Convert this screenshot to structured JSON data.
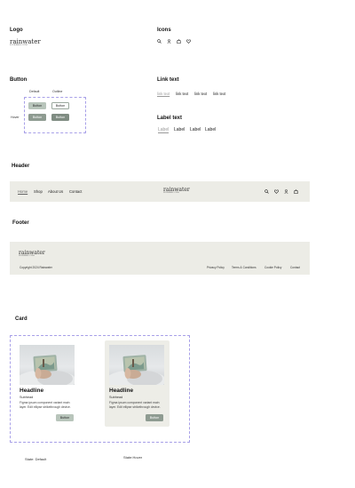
{
  "sections": {
    "logo": "Logo",
    "icons": "Icons",
    "button": "Button",
    "link_text": "Link text",
    "label_text": "Label text",
    "header": "Header",
    "footer": "Footer",
    "card": "Card"
  },
  "brand": {
    "name": "rainwater",
    "tagline": "SUSTAINABLE LIVING"
  },
  "icons": [
    "search-icon",
    "user-icon",
    "bag-icon",
    "heart-icon"
  ],
  "buttons": {
    "col_default": "Default",
    "col_outline": "Outline",
    "row_hover": "Hover",
    "label": "Button"
  },
  "links": [
    "link text",
    "link text",
    "link text",
    "link text"
  ],
  "labels": [
    "Label",
    "Label",
    "Label",
    "Label"
  ],
  "header": {
    "nav": [
      "Home",
      "Shop",
      "About Us",
      "Contact"
    ]
  },
  "footer": {
    "copyright": "Copyright 2024 Rainwater",
    "links": [
      "Privacy Policy",
      "Terms & Conditions",
      "Cookie Policy",
      "Contact"
    ]
  },
  "card": {
    "headline": "Headline",
    "subhead": "Subhead",
    "body_line1": "Figma ipsum component variant main",
    "body_line2": "layer. Edit ellipse strikethrough device.",
    "button": "Button",
    "state_default": "State: Default",
    "state_hover": "State:Hover"
  },
  "colors": {
    "sage": "#b8c5bb",
    "sage_dark": "#8e9b91",
    "band": "#ececE6",
    "dashed_outline": "#a8a0e8"
  }
}
